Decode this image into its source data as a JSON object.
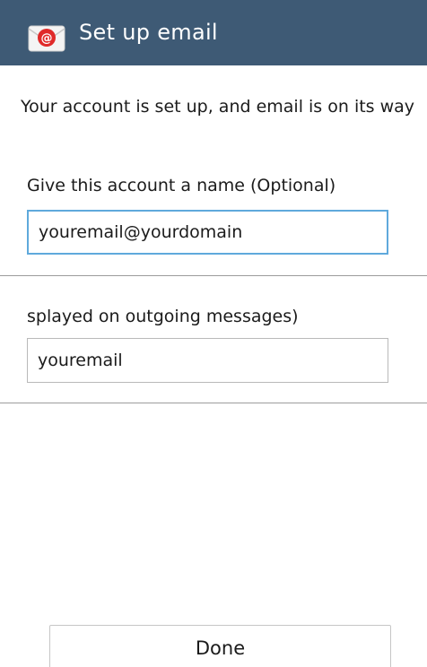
{
  "action_bar": {
    "icon": "email-app-icon",
    "title": "Set up email",
    "background": "#3e5a75"
  },
  "message": "Your account is set up, and email is on its way",
  "account_name": {
    "label": "Give this account a name (Optional)",
    "value": "youremail@yourdomain"
  },
  "sender_name": {
    "label": "splayed on outgoing messages)",
    "value": "youremail"
  },
  "done_button": {
    "label": "Done"
  },
  "colors": {
    "focus_border": "#5fa9dc",
    "icon_red": "#e02a2a"
  }
}
